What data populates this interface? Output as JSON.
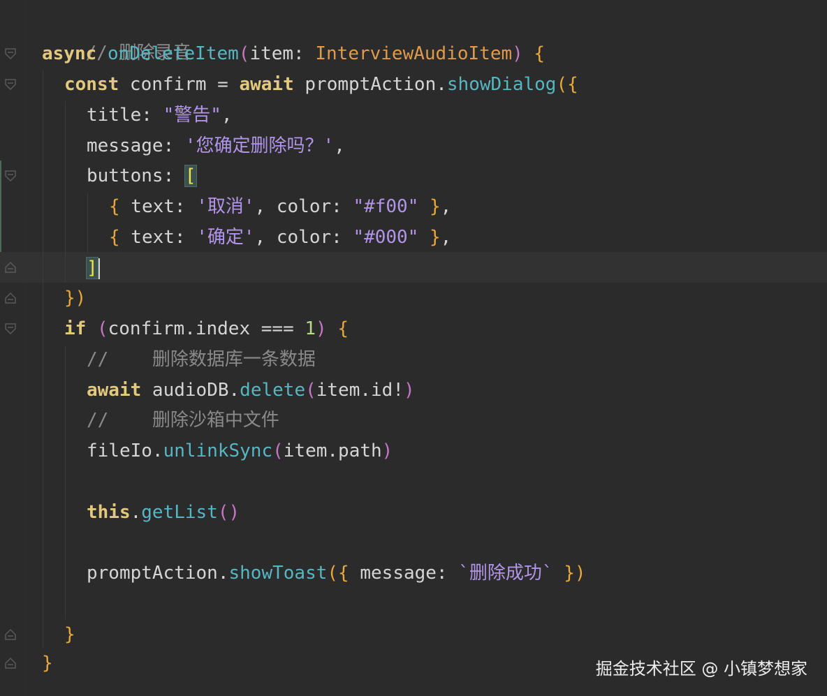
{
  "colors": {
    "background": "#2b2b2b",
    "current_line": "#323232",
    "keyword": "#e3c97e",
    "function": "#56b6c2",
    "type": "#e09a4a",
    "string": "#b294e8",
    "number": "#b7d98a",
    "comment": "#8a8a8a",
    "text": "#d5d5d5",
    "brace": "#e8a83a"
  },
  "code": {
    "comment_delete_recording": "// 删除录音",
    "l1": {
      "async": "async",
      "fn_name": "onDeleteItem",
      "paren_open": "(",
      "param": "item: ",
      "type": "InterviewAudioItem",
      "paren_close": ")",
      "brace": " {"
    },
    "l2": {
      "const": "const",
      "decl": " confirm = ",
      "await": "await",
      "obj": " promptAction.",
      "method": "showDialog",
      "open": "({"
    },
    "l3": {
      "key": "title: ",
      "value": "\"警告\"",
      "tail": ","
    },
    "l4": {
      "key": "message: ",
      "value": "'您确定删除吗？'",
      "tail": ","
    },
    "l5": {
      "key": "buttons: ",
      "bracket": "["
    },
    "l6": {
      "open": "{",
      "text_key": " text: ",
      "text_val": "'取消'",
      "sep": ", color: ",
      "color_val": "\"#f00\"",
      "close": " }",
      "tail": ","
    },
    "l7": {
      "open": "{",
      "text_key": " text: ",
      "text_val": "'确定'",
      "sep": ", color: ",
      "color_val": "\"#000\"",
      "close": " }",
      "tail": ","
    },
    "l8": {
      "bracket": "]"
    },
    "l9": {
      "close": "})"
    },
    "l10": {
      "if": "if",
      "open": " (",
      "cond": "confirm.index === ",
      "num": "1",
      "close": ")",
      "brace": " {"
    },
    "l11": {
      "comment": "//    删除数据库一条数据"
    },
    "l12": {
      "await": "await",
      "obj": " audioDB.",
      "method": "delete",
      "open": "(",
      "arg": "item.id!",
      "close": ")"
    },
    "l13": {
      "comment": "//    删除沙箱中文件"
    },
    "l14": {
      "obj": "fileIo.",
      "method": "unlinkSync",
      "open": "(",
      "arg": "item.path",
      "close": ")"
    },
    "l15": {
      "this": "this",
      "dot": ".",
      "method": "getList",
      "parens": "()"
    },
    "l16": {
      "obj": "promptAction.",
      "method": "showToast",
      "open": "({",
      "key": " message: ",
      "value": "`删除成功`",
      "close": " })"
    },
    "l17": {
      "brace": "}"
    },
    "l18": {
      "brace": "}"
    }
  },
  "watermark": "掘金技术社区 @ 小镇梦想家"
}
